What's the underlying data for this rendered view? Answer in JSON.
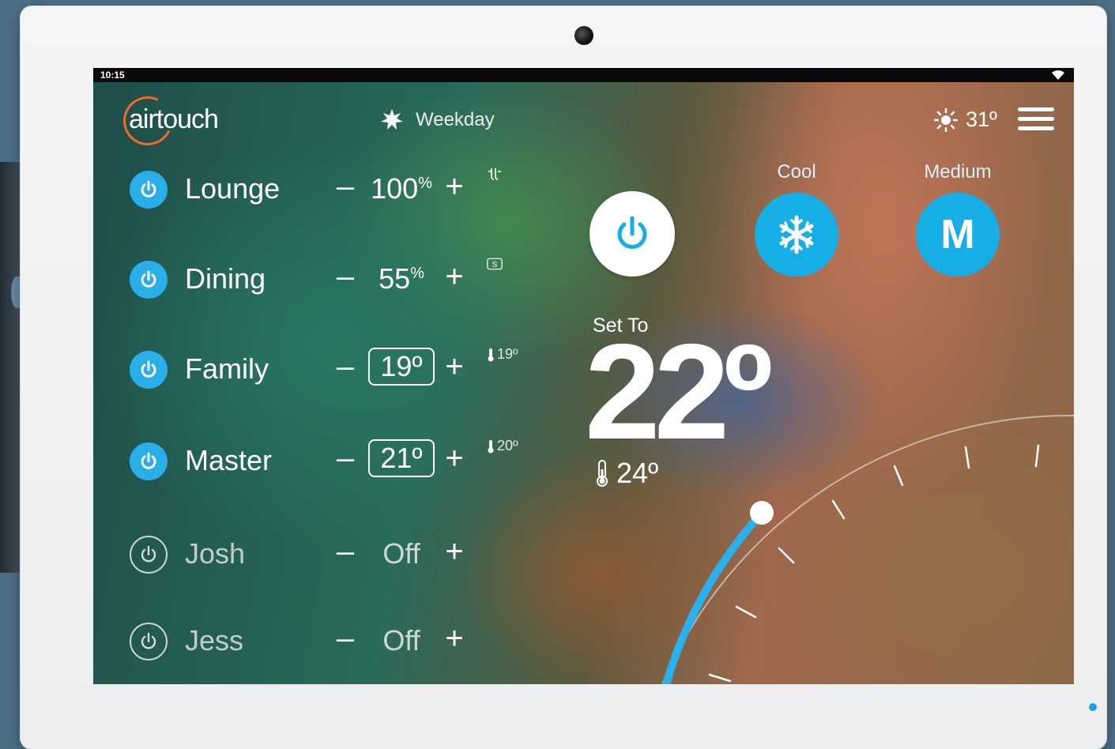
{
  "status": {
    "time": "10:15"
  },
  "brand": {
    "logo_text": "airtouch"
  },
  "schedule": {
    "label": "Weekday"
  },
  "weather": {
    "temp": "31º"
  },
  "zones": [
    {
      "name": "Lounge",
      "value": "100",
      "unit": "%",
      "on": true,
      "sensor": ""
    },
    {
      "name": "Dining",
      "value": "55",
      "unit": "%",
      "on": true,
      "sensor": ""
    },
    {
      "name": "Family",
      "value": "19º",
      "unit": "",
      "on": true,
      "sensor": "19º"
    },
    {
      "name": "Master",
      "value": "21º",
      "unit": "",
      "on": true,
      "sensor": "20º"
    },
    {
      "name": "Josh",
      "value": "Off",
      "unit": "",
      "on": false,
      "sensor": ""
    },
    {
      "name": "Jess",
      "value": "Off",
      "unit": "",
      "on": false,
      "sensor": ""
    }
  ],
  "controls": {
    "minus": "–",
    "plus": "+"
  },
  "ac": {
    "mode_label": "Cool",
    "fan_label": "Medium",
    "fan_short": "M",
    "set_to_label": "Set To",
    "set_temp": "22º",
    "current_temp": "24º"
  },
  "colors": {
    "accent": "#17aee8",
    "logo_ring": "#f26a2a"
  }
}
